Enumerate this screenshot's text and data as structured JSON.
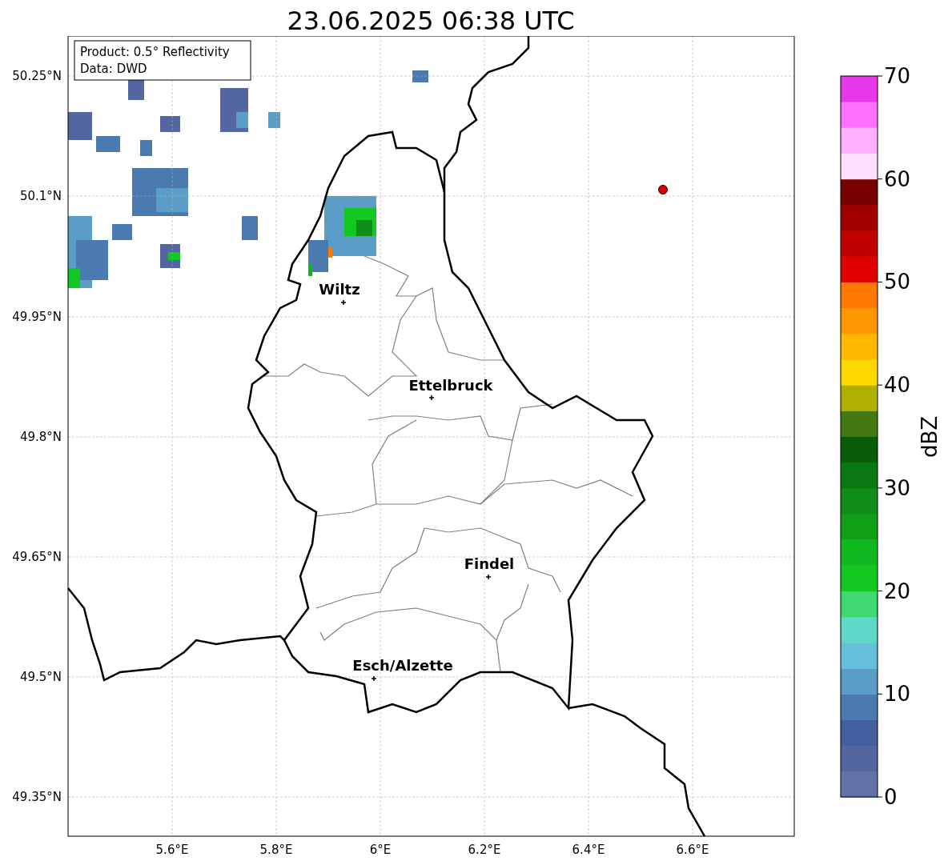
{
  "title": "23.06.2025 06:38 UTC",
  "info_box": {
    "lines": [
      "Product: 0.5° Reflectivity",
      "Data: DWD"
    ]
  },
  "lat_labels": [
    "50.25°N",
    "50.1°N",
    "49.95°N",
    "49.8°N",
    "49.65°N",
    "49.5°N",
    "49.35°N"
  ],
  "lon_labels": [
    "5.6°E",
    "5.8°E",
    "6°E",
    "6.2°E",
    "6.4°E",
    "6.6°E"
  ],
  "cities": [
    {
      "name": "Wiltz"
    },
    {
      "name": "Ettelbruck"
    },
    {
      "name": "Findel"
    },
    {
      "name": "Esch/Alzette"
    }
  ],
  "colorbar": {
    "label": "dBZ",
    "ticks": [
      "70",
      "60",
      "50",
      "40",
      "30",
      "20",
      "10",
      "0"
    ],
    "segments": [
      {
        "color": "#6272a6"
      },
      {
        "color": "#5466a0"
      },
      {
        "color": "#435fa0"
      },
      {
        "color": "#4a7ab0"
      },
      {
        "color": "#5a9ec8"
      },
      {
        "color": "#66c0dc"
      },
      {
        "color": "#60d8c8"
      },
      {
        "color": "#40d870"
      },
      {
        "color": "#10c820"
      },
      {
        "color": "#10b820"
      },
      {
        "color": "#10a018"
      },
      {
        "color": "#108c18"
      },
      {
        "color": "#0a7810"
      },
      {
        "color": "#085c0a"
      },
      {
        "color": "#447810"
      },
      {
        "color": "#b0b000"
      },
      {
        "color": "#ffd800"
      },
      {
        "color": "#ffb800"
      },
      {
        "color": "#ff9800"
      },
      {
        "color": "#ff7800"
      },
      {
        "color": "#e00000"
      },
      {
        "color": "#c00000"
      },
      {
        "color": "#a00000"
      },
      {
        "color": "#780000"
      },
      {
        "color": "#ffe0ff"
      },
      {
        "color": "#ffb0ff"
      },
      {
        "color": "#ff70ff"
      },
      {
        "color": "#e838ec"
      }
    ]
  }
}
